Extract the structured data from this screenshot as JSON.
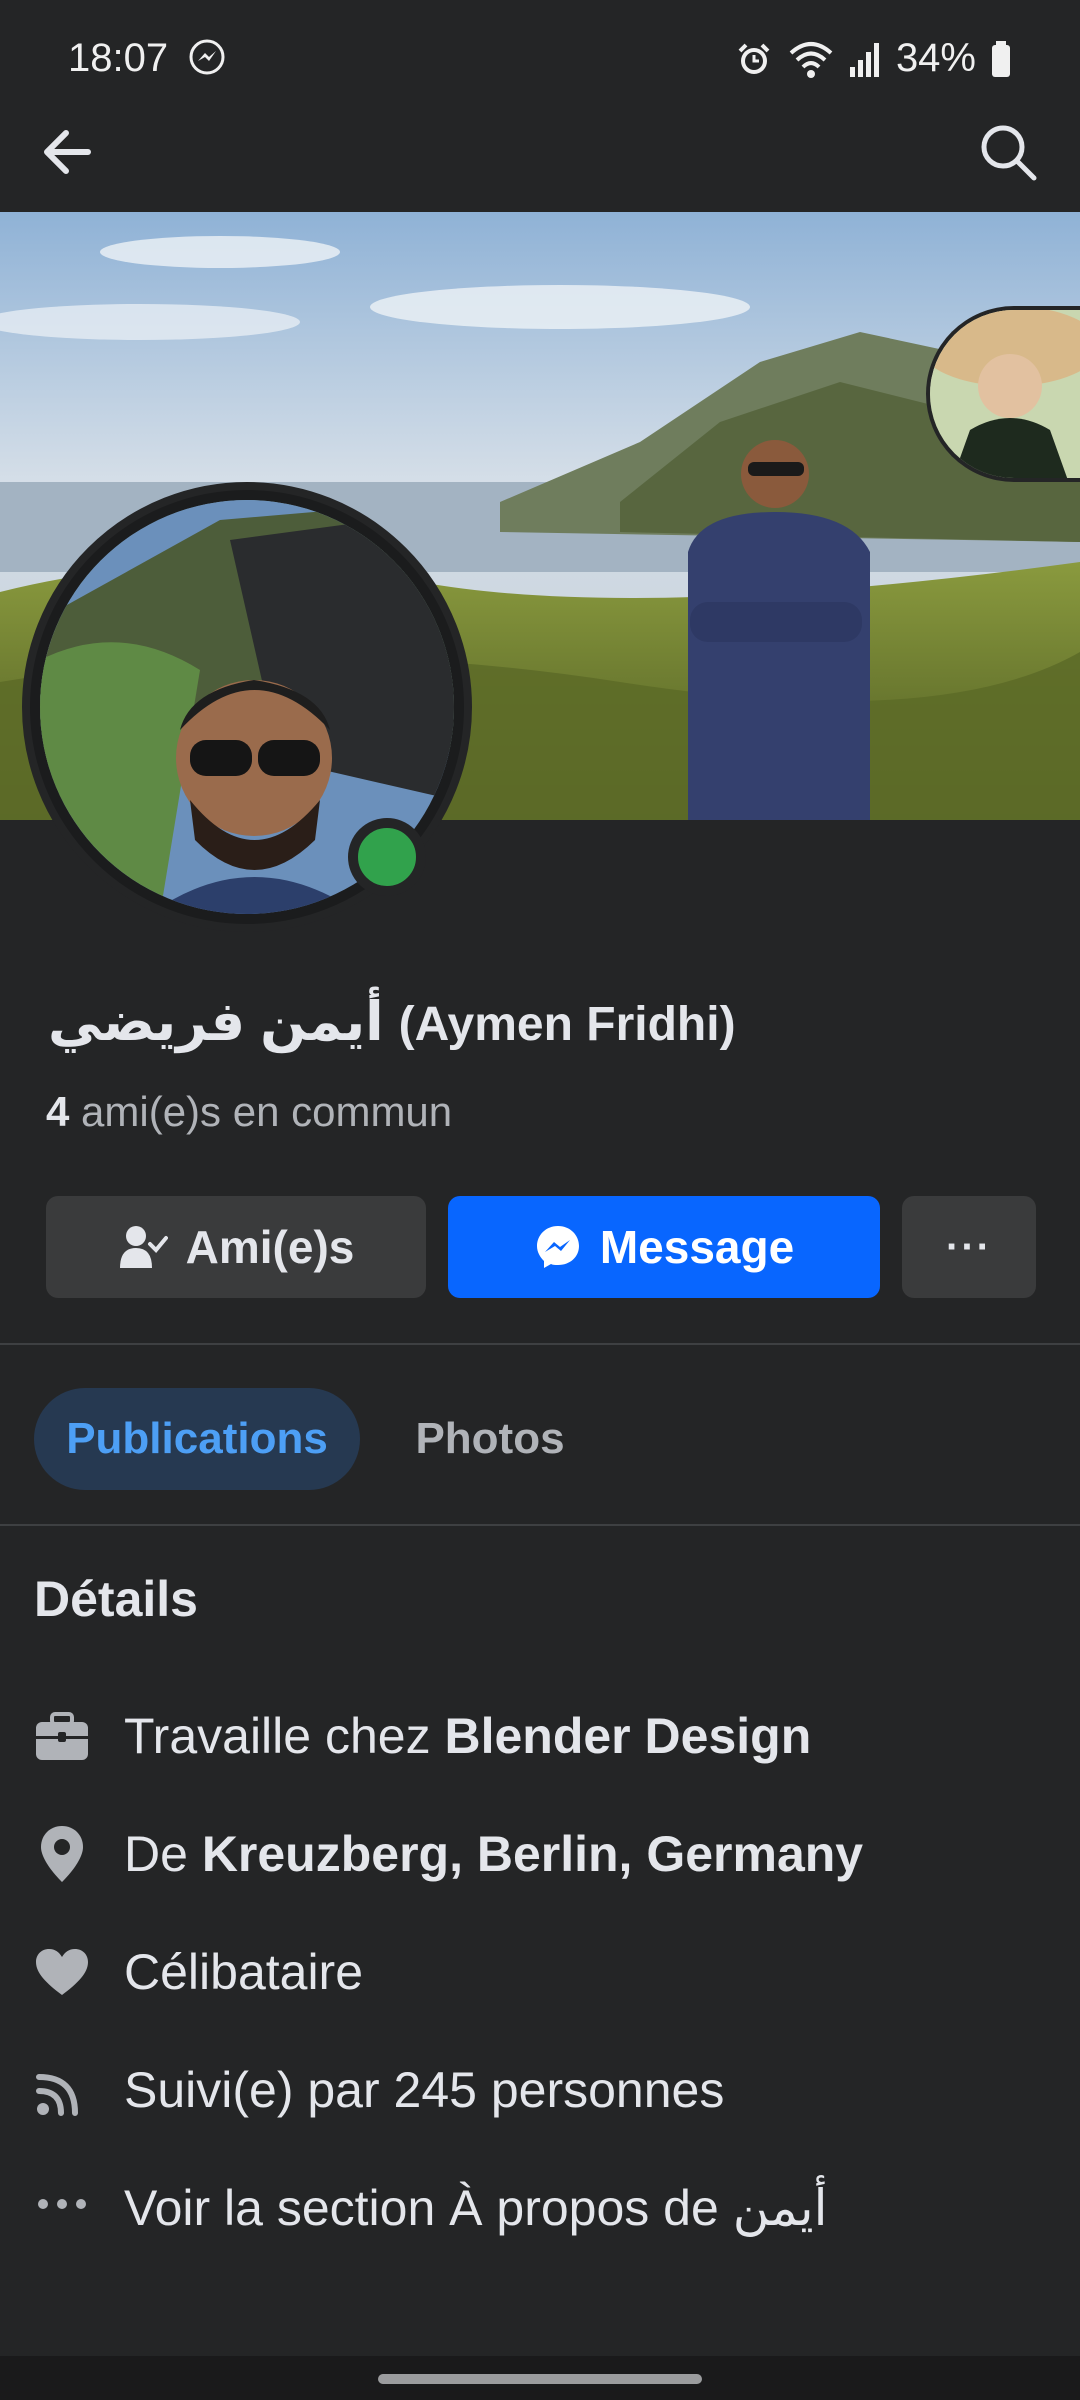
{
  "status_bar": {
    "time": "18:07",
    "battery": "34%",
    "icons": [
      "messenger-status-icon",
      "alarm-icon",
      "wifi-icon",
      "signal-icon",
      "battery-icon"
    ]
  },
  "header": {
    "back_icon": "arrow-left-icon",
    "search_icon": "search-icon"
  },
  "profile": {
    "name_arabic": "أيمن فريضي",
    "name_latin": "(Aymen Fridhi)",
    "mutual_count": "4",
    "mutual_label": "ami(e)s en commun",
    "online": true
  },
  "actions": {
    "friends_label": "Ami(e)s",
    "message_label": "Message",
    "more_label": "···"
  },
  "tabs": [
    {
      "label": "Publications",
      "active": true
    },
    {
      "label": "Photos",
      "active": false
    }
  ],
  "details": {
    "title": "Détails",
    "work_prefix": "Travaille chez ",
    "work_value": "Blender Design",
    "from_prefix": "De ",
    "from_value": "Kreuzberg, Berlin, Germany",
    "relationship": "Célibataire",
    "followers": "Suivi(e) par 245 personnes",
    "about_link": "Voir la section À propos de أيمن"
  },
  "colors": {
    "background": "#242526",
    "primary_button": "#0866ff",
    "secondary_button": "#3a3b3c",
    "active_tab_bg": "#263951",
    "active_tab_text": "#4d9ff5",
    "online": "#31a24c"
  }
}
